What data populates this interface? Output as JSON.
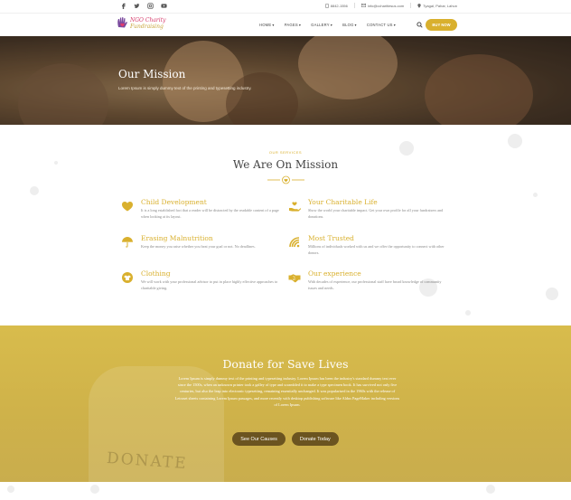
{
  "topbar": {
    "social": [
      "facebook-icon",
      "twitter-icon",
      "instagram-icon",
      "youtube-icon"
    ],
    "phone": "8842-1556",
    "email": "info@ccharitiesus.com",
    "address": "Tyagal, Pahar, Lahun"
  },
  "header": {
    "logo_line1": "NGO Charity",
    "logo_line2": "Fundraising",
    "nav": [
      "HOME",
      "PAGES",
      "GALLERY",
      "BLOG",
      "CONTACT US"
    ],
    "buy_label": "BUY NOW"
  },
  "hero": {
    "title": "Our Mission",
    "subtitle": "Lorem Ipsum is simply dummy text of the printing and typesetting industry."
  },
  "mission": {
    "eyebrow": "OUR SERVICES",
    "title": "We Are On Mission",
    "features": [
      {
        "icon": "heart-icon",
        "title": "Child Development",
        "desc": "It is a long established fact that a reader will be distracted by the readable content of a page when looking at its layout."
      },
      {
        "icon": "charity-hand-icon",
        "title": "Your Charitable Life",
        "desc": "Show the world your charitable impact. Get your own profile for all your fundraisers and donations."
      },
      {
        "icon": "umbrella-icon",
        "title": "Erasing Malnutrition",
        "desc": "Keep the money you raise whether you beat your goal or not. No deadlines."
      },
      {
        "icon": "signal-icon",
        "title": "Most Trusted",
        "desc": "Millions of individuals worked with us and we offer the opportunity to connect with other donors."
      },
      {
        "icon": "clothing-icon",
        "title": "Clothing",
        "desc": "We will work with your professional advisor to put in place highly effective approaches to charitable giving."
      },
      {
        "icon": "handshake-icon",
        "title": "Our experience",
        "desc": "With decades of experience, our professional staff have broad knowledge of community issues and needs."
      }
    ]
  },
  "donate": {
    "title": "Donate for Save Lives",
    "text": "Lorem Ipsum is simply dummy text of the printing and typesetting industry. Lorem Ipsum has been the industry's standard dummy text ever since the 1500s, when an unknown printer took a galley of type and scrambled it to make a type specimen book. It has survived not only five centuries, but also the leap into electronic typesetting, remaining essentially unchanged. It was popularised in the 1960s with the release of Letraset sheets containing Lorem Ipsum passages, and more recently with desktop publishing software like Aldus PageMaker including versions of Lorem Ipsum.",
    "jar_label": "DONATE",
    "btn1": "See Our Causes",
    "btn2": "Donate Today"
  },
  "colors": {
    "accent": "#d9b02e",
    "donate_bg": "#d3b64b",
    "button_dark": "#6b5420"
  }
}
